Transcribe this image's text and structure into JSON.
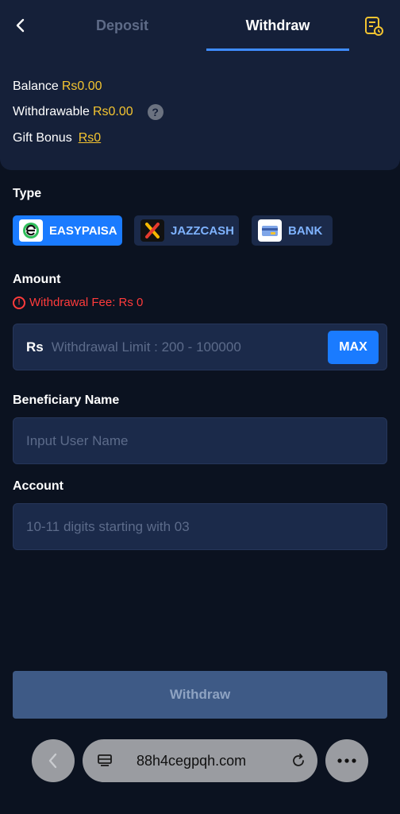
{
  "header": {
    "tabs": [
      {
        "label": "Deposit",
        "active": false
      },
      {
        "label": "Withdraw",
        "active": true
      }
    ],
    "back_icon": "chevron-left-icon",
    "records_icon": "records-icon"
  },
  "balance": {
    "balance_label": "Balance",
    "balance_value": "Rs0.00",
    "withdrawable_label": "Withdrawable",
    "withdrawable_value": "Rs0.00",
    "help_symbol": "?",
    "gift_label": "Gift Bonus",
    "gift_value": "Rs0"
  },
  "type": {
    "label": "Type",
    "options": [
      {
        "label": "EASYPAISA",
        "active": true
      },
      {
        "label": "JAZZCASH",
        "active": false
      },
      {
        "label": "BANK",
        "active": false
      }
    ]
  },
  "amount": {
    "label": "Amount",
    "fee_text": "Withdrawal Fee: Rs 0",
    "currency": "Rs",
    "placeholder": "Withdrawal Limit : 200 - 100000",
    "value": "",
    "max_label": "MAX"
  },
  "beneficiary": {
    "label": "Beneficiary Name",
    "placeholder": "Input User Name",
    "value": ""
  },
  "account": {
    "label": "Account",
    "placeholder": "10-11 digits starting with 03",
    "value": ""
  },
  "submit_label": "Withdraw",
  "browser": {
    "url": "88h4cegpqh.com"
  },
  "colors": {
    "background": "#0b1220",
    "card": "#152039",
    "accent": "#1a7bff",
    "balance_value": "#f4c430",
    "error": "#ff3b3b"
  }
}
